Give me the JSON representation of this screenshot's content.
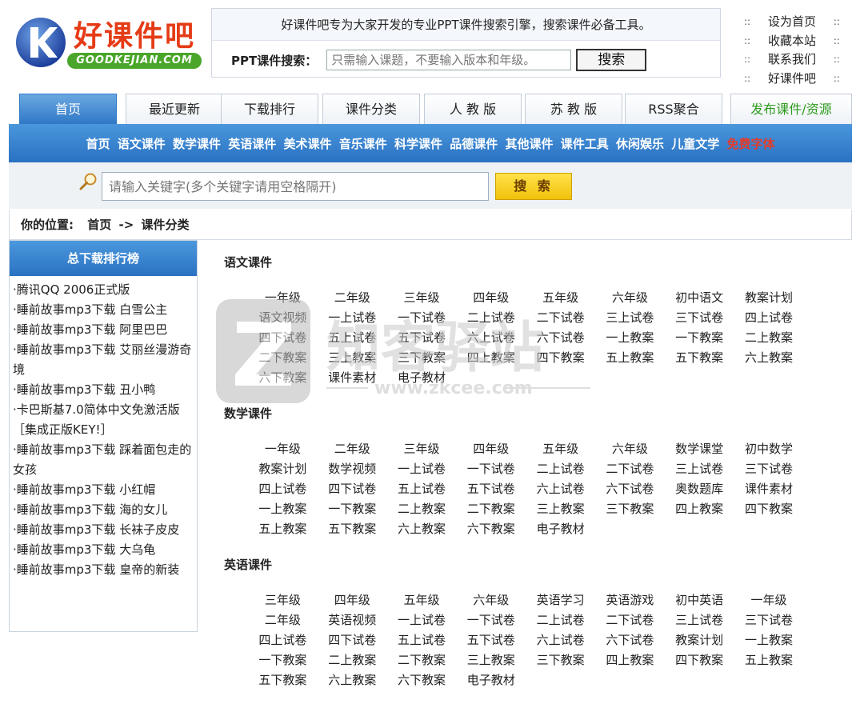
{
  "logo": {
    "brand": "好课件吧",
    "domain": "GOODKEJIAN.COM"
  },
  "header": {
    "slogan": "好课件吧专为大家开发的专业PPT课件搜索引擎，搜索课件必备工具。",
    "search_label": "PPT课件搜索：",
    "search_placeholder": "只需输入课题，不要输入版本和年级。",
    "search_button": "搜索"
  },
  "quick_links": [
    "设为首页",
    "收藏本站",
    "联系我们",
    "好课件吧"
  ],
  "tabs": [
    "首页",
    "最近更新",
    "下载排行",
    "课件分类",
    "人 教 版",
    "苏 教 版",
    "RSS聚合",
    "发布课件/资源"
  ],
  "subnav": [
    "首页",
    "语文课件",
    "数学课件",
    "英语课件",
    "美术课件",
    "音乐课件",
    "科学课件",
    "品德课件",
    "其他课件",
    "课件工具",
    "休闲娱乐",
    "儿童文学",
    "免费字体"
  ],
  "keyword_search": {
    "placeholder": "请输入关键字(多个关键字请用空格隔开)",
    "button": "搜 索"
  },
  "breadcrumb": {
    "label": "你的位置:",
    "home": "首页",
    "arrow": "->",
    "current": "课件分类"
  },
  "sidebar": {
    "title": "总下载排行榜",
    "items": [
      "·腾讯QQ 2006正式版",
      "·睡前故事mp3下载 白雪公主",
      "·睡前故事mp3下载 阿里巴巴",
      "·睡前故事mp3下载 艾丽丝漫游奇境",
      "·睡前故事mp3下载 丑小鸭",
      "·卡巴斯基7.0简体中文免激活版［集成正版KEY!］",
      "·睡前故事mp3下载 踩着面包走的女孩",
      "·睡前故事mp3下载 小红帽",
      "·睡前故事mp3下载 海的女儿",
      "·睡前故事mp3下载 长袜子皮皮",
      "·睡前故事mp3下载 大乌龟",
      "·睡前故事mp3下载 皇帝的新装"
    ]
  },
  "sections": [
    {
      "title": "语文课件",
      "items": [
        "一年级",
        "二年级",
        "三年级",
        "四年级",
        "五年级",
        "六年级",
        "初中语文",
        "教案计划",
        "语文视频",
        "一上试卷",
        "一下试卷",
        "二上试卷",
        "二下试卷",
        "三上试卷",
        "三下试卷",
        "四上试卷",
        "四下试卷",
        "五上试卷",
        "五下试卷",
        "六上试卷",
        "六下试卷",
        "一上教案",
        "一下教案",
        "二上教案",
        "二下教案",
        "三上教案",
        "三下教案",
        "四上教案",
        "四下教案",
        "五上教案",
        "五下教案",
        "六上教案",
        "六下教案",
        "课件素材",
        "电子教材"
      ]
    },
    {
      "title": "数学课件",
      "items": [
        "一年级",
        "二年级",
        "三年级",
        "四年级",
        "五年级",
        "六年级",
        "数学课堂",
        "初中数学",
        "教案计划",
        "数学视频",
        "一上试卷",
        "一下试卷",
        "二上试卷",
        "二下试卷",
        "三上试卷",
        "三下试卷",
        "四上试卷",
        "四下试卷",
        "五上试卷",
        "五下试卷",
        "六上试卷",
        "六下试卷",
        "奥数题库",
        "课件素材",
        "一上教案",
        "一下教案",
        "二上教案",
        "二下教案",
        "三上教案",
        "三下教案",
        "四上教案",
        "四下教案",
        "五上教案",
        "五下教案",
        "六上教案",
        "六下教案",
        "电子教材"
      ]
    },
    {
      "title": "英语课件",
      "items": [
        "三年级",
        "四年级",
        "五年级",
        "六年级",
        "英语学习",
        "英语游戏",
        "初中英语",
        "一年级",
        "二年级",
        "英语视频",
        "一上试卷",
        "一下试卷",
        "二上试卷",
        "二下试卷",
        "三上试卷",
        "三下试卷",
        "四上试卷",
        "四下试卷",
        "五上试卷",
        "五下试卷",
        "六上试卷",
        "六下试卷",
        "教案计划",
        "一上教案",
        "一下教案",
        "二上教案",
        "二下教案",
        "三上教案",
        "三下教案",
        "四上教案",
        "四下教案",
        "五上教案",
        "五下教案",
        "六上教案",
        "六下教案",
        "电子教材"
      ]
    }
  ],
  "watermark": {
    "text": "知客驿站",
    "url": "www.zkcee.com"
  },
  "colors": {
    "brand_red": "#e53b16",
    "nav_blue": "#2f78c7",
    "green": "#2f9b1f",
    "alert_red": "#e33b2a"
  }
}
